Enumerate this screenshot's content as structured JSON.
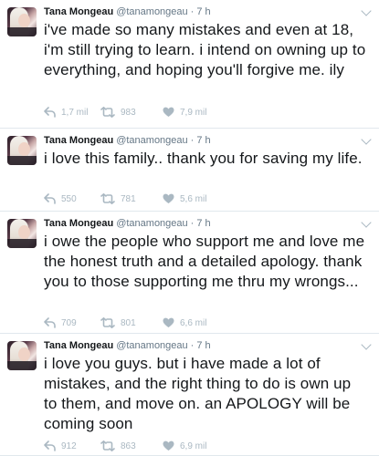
{
  "tweets": [
    {
      "name": "Tana Mongeau",
      "handle": "@tanamongeau",
      "time": "7 h",
      "text": "i've made so many mistakes and even at 18, i'm still trying to learn. i intend on owning up to everything, and hoping you'll forgive me. ily",
      "replies": "1,7 mil",
      "retweets": "983",
      "likes": "7,9 mil"
    },
    {
      "name": "Tana Mongeau",
      "handle": "@tanamongeau",
      "time": "7 h",
      "text": "i love this family.. thank you for saving my life.",
      "replies": "550",
      "retweets": "781",
      "likes": "5,6 mil"
    },
    {
      "name": "Tana Mongeau",
      "handle": "@tanamongeau",
      "time": "7 h",
      "text": "i owe the people who support me and love me the honest truth and a detailed apology. thank you to those supporting me thru my wrongs...",
      "replies": "709",
      "retweets": "801",
      "likes": "6,6 mil"
    },
    {
      "name": "Tana Mongeau",
      "handle": "@tanamongeau",
      "time": "7 h",
      "text": "i love you guys. but i have made a lot of mistakes, and the right thing to do is own up to them, and move on. an APOLOGY will be coming soon",
      "replies": "912",
      "retweets": "863",
      "likes": "6,9 mil"
    }
  ],
  "icons": {
    "reply": "reply-icon",
    "retweet": "retweet-icon",
    "like": "heart-icon",
    "more": "chevron-down-icon"
  },
  "colors": {
    "background": "#e6ecf0",
    "card": "#ffffff",
    "text": "#14171a",
    "secondary": "#657786",
    "action": "#aab8c2"
  }
}
